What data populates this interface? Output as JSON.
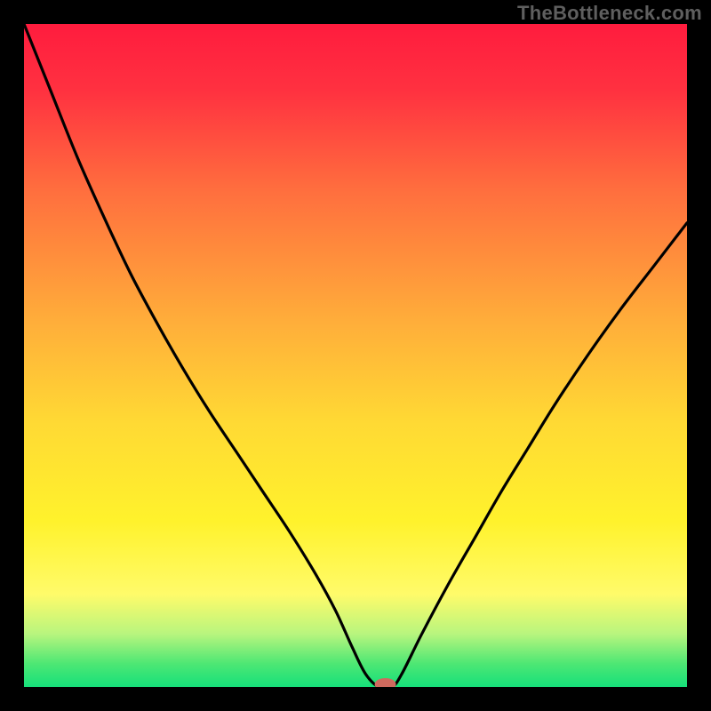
{
  "watermark": "TheBottleneck.com",
  "chart_data": {
    "type": "line",
    "title": "",
    "xlabel": "",
    "ylabel": "",
    "xlim": [
      0,
      100
    ],
    "ylim": [
      0,
      100
    ],
    "grid": false,
    "legend": false,
    "background_gradient": {
      "stops": [
        {
          "offset": 0.0,
          "color": "#ff1c3e"
        },
        {
          "offset": 0.1,
          "color": "#ff3140"
        },
        {
          "offset": 0.25,
          "color": "#ff6e3e"
        },
        {
          "offset": 0.45,
          "color": "#ffae3a"
        },
        {
          "offset": 0.6,
          "color": "#ffd934"
        },
        {
          "offset": 0.75,
          "color": "#fff22c"
        },
        {
          "offset": 0.86,
          "color": "#fffb6a"
        },
        {
          "offset": 0.92,
          "color": "#b8f57e"
        },
        {
          "offset": 0.965,
          "color": "#4de774"
        },
        {
          "offset": 1.0,
          "color": "#16e07a"
        }
      ]
    },
    "series": [
      {
        "name": "bottleneck-curve",
        "color": "#000000",
        "x": [
          0.0,
          4.0,
          8.0,
          12.0,
          16.0,
          20.0,
          24.0,
          28.0,
          32.0,
          36.0,
          40.0,
          44.0,
          47.0,
          49.5,
          51.5,
          53.5,
          55.5,
          57.0,
          60.0,
          64.0,
          68.0,
          72.0,
          76.0,
          80.0,
          85.0,
          90.0,
          95.0,
          100.0
        ],
        "y": [
          100.0,
          90.0,
          80.0,
          71.0,
          62.5,
          55.0,
          48.0,
          41.5,
          35.5,
          29.5,
          23.5,
          17.0,
          11.5,
          6.0,
          2.0,
          0.0,
          0.0,
          2.0,
          8.0,
          15.5,
          22.5,
          29.5,
          36.0,
          42.5,
          50.0,
          57.0,
          63.5,
          70.0
        ]
      }
    ],
    "marker": {
      "name": "min-marker",
      "x": 54.5,
      "y": 0.0,
      "color": "#cf6a5e",
      "rx": 12,
      "ry": 7
    }
  }
}
